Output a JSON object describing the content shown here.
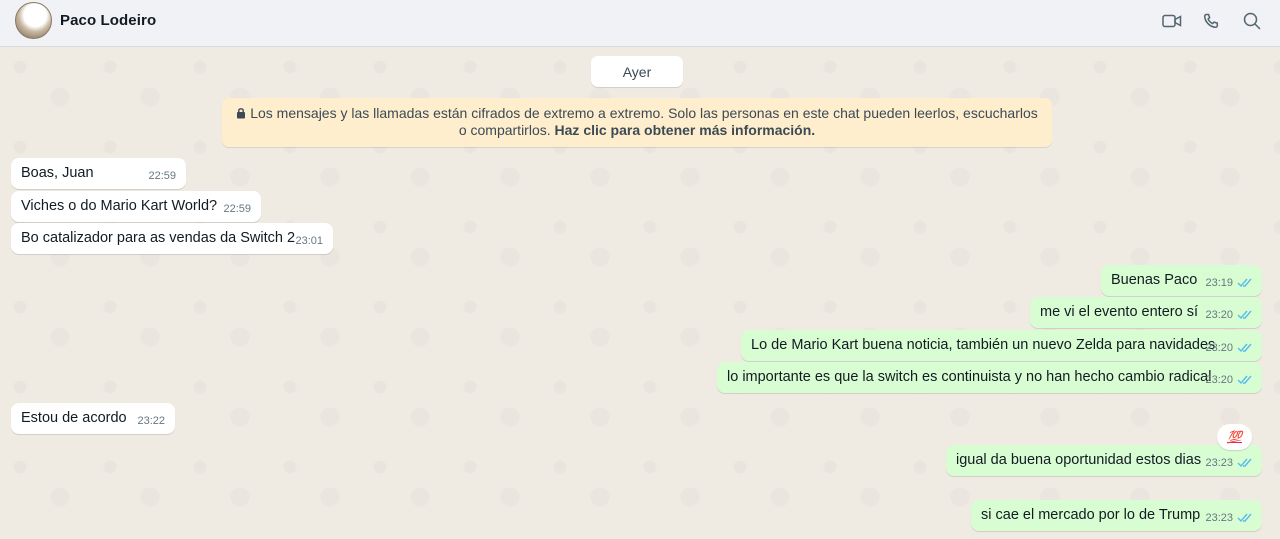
{
  "header": {
    "contact_name": "Paco  Lodeiro",
    "icons": [
      "video-call-icon",
      "voice-call-icon",
      "search-icon"
    ]
  },
  "chat": {
    "date_label": "Ayer",
    "encryption_notice": {
      "text": "Los mensajes y las llamadas están cifrados de extremo a extremo. Solo las personas en este chat pueden leerlos, escucharlos o compartirlos.",
      "link": "Haz clic para obtener más información."
    },
    "messages": [
      {
        "direction": "in",
        "text": "Boas, Juan",
        "time": "22:59"
      },
      {
        "direction": "in",
        "text": "Viches o do Mario Kart World?",
        "time": "22:59"
      },
      {
        "direction": "in",
        "text": "Bo catalizador para as vendas da Switch 2",
        "time": "23:01"
      },
      {
        "direction": "out",
        "text": "Buenas Paco",
        "time": "23:19",
        "status": "read"
      },
      {
        "direction": "out",
        "text": "me vi el evento entero sí",
        "time": "23:20",
        "status": "read"
      },
      {
        "direction": "out",
        "text": "Lo de Mario Kart buena noticia, también un nuevo Zelda para navidades",
        "time": "23:20",
        "status": "read"
      },
      {
        "direction": "out",
        "text": "lo importante es que la switch es continuista y no han hecho cambio radical",
        "time": "23:20",
        "status": "read"
      },
      {
        "direction": "in",
        "text": "Estou de acordo",
        "time": "23:22"
      },
      {
        "direction": "out",
        "text": "igual da buena oportunidad estos dias",
        "time": "23:23",
        "status": "read",
        "reaction": "💯"
      },
      {
        "direction": "out",
        "text": "si cae el mercado por lo de Trump",
        "time": "23:23",
        "status": "read"
      }
    ]
  },
  "colors": {
    "incoming_bubble": "#ffffff",
    "outgoing_bubble": "#d9fdd3",
    "read_ticks": "#53bdeb",
    "notice_bg": "#ffeecd"
  }
}
